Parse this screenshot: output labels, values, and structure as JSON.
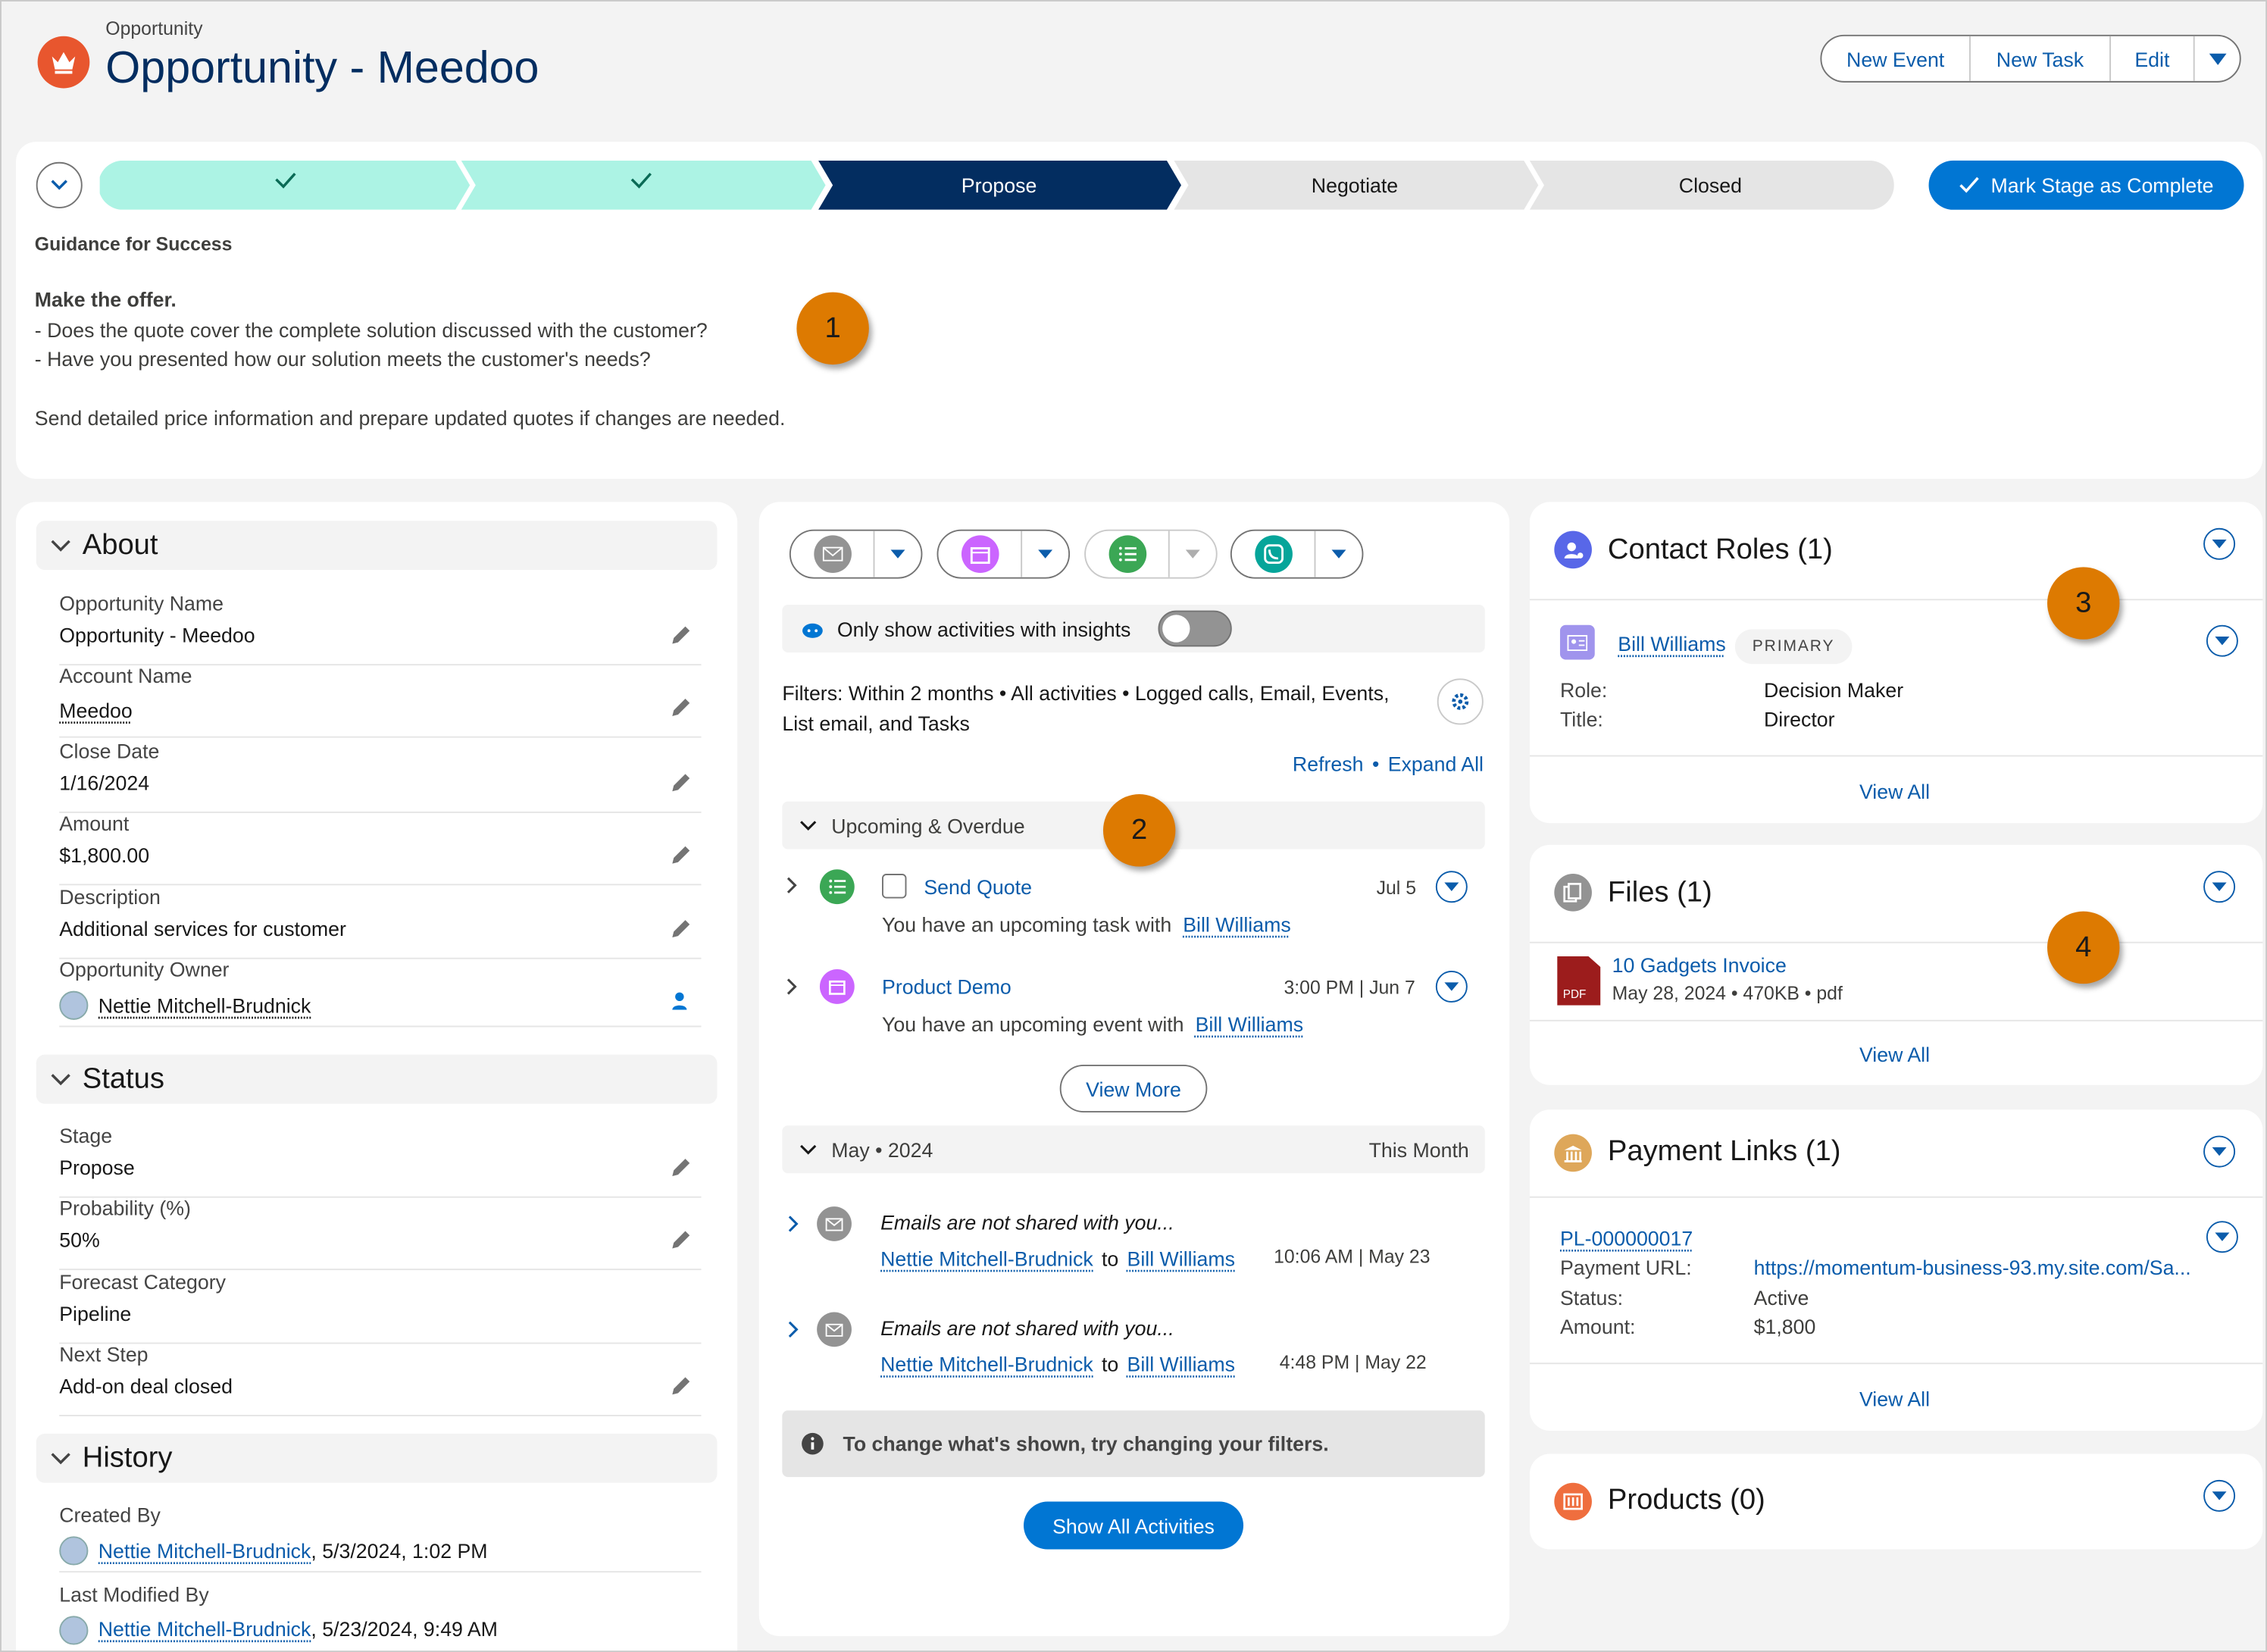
{
  "header": {
    "object_type": "Opportunity",
    "title": "Opportunity - Meedoo",
    "buttons": {
      "new_event": "New Event",
      "new_task": "New Task",
      "edit": "Edit"
    }
  },
  "path": {
    "stages": [
      "",
      "",
      "Propose",
      "Negotiate",
      "Closed"
    ],
    "mark_complete": "Mark Stage as Complete",
    "guidance_title": "Guidance for Success",
    "guidance_heading": "Make the offer.",
    "guidance_lines": [
      "- Does the quote cover the complete solution discussed with the customer?",
      "- Have you presented how our solution meets the customer's needs?"
    ],
    "guidance_footer": "Send detailed price information and prepare updated quotes if changes are needed."
  },
  "callouts": [
    "1",
    "2",
    "3",
    "4"
  ],
  "about": {
    "title": "About",
    "fields": [
      {
        "label": "Opportunity Name",
        "value": "Opportunity - Meedoo"
      },
      {
        "label": "Account Name",
        "value": "Meedoo"
      },
      {
        "label": "Close Date",
        "value": "1/16/2024"
      },
      {
        "label": "Amount",
        "value": "$1,800.00"
      },
      {
        "label": "Description",
        "value": "Additional services for customer"
      },
      {
        "label": "Opportunity Owner",
        "value": "Nettie Mitchell-Brudnick"
      }
    ]
  },
  "status": {
    "title": "Status",
    "fields": [
      {
        "label": "Stage",
        "value": "Propose"
      },
      {
        "label": "Probability (%)",
        "value": "50%"
      },
      {
        "label": "Forecast Category",
        "value": "Pipeline"
      },
      {
        "label": "Next Step",
        "value": "Add-on deal closed"
      }
    ]
  },
  "history": {
    "title": "History",
    "created_label": "Created By",
    "created_by": "Nettie Mitchell-Brudnick",
    "created_date": ", 5/3/2024, 1:02 PM",
    "modified_label": "Last Modified By",
    "modified_by": "Nettie Mitchell-Brudnick",
    "modified_date": ", 5/23/2024, 9:49 AM"
  },
  "activity": {
    "insights_toggle_label": "Only show activities with insights",
    "filters_text": "Filters: Within 2 months • All activities • Logged calls, Email, Events, List email, and Tasks",
    "refresh": "Refresh",
    "expand_all": "Expand All",
    "upcoming_title": "Upcoming & Overdue",
    "task": {
      "title": "Send Quote",
      "date": "Jul 5",
      "text": "You have an upcoming task with",
      "person": "Bill Williams"
    },
    "event": {
      "title": "Product Demo",
      "date": "3:00 PM | Jun 7",
      "text": "You have an upcoming event with",
      "person": "Bill Williams"
    },
    "view_more": "View More",
    "month_title": "May • 2024",
    "month_badge": "This Month",
    "emails": [
      {
        "subject": "Emails are not shared with you...",
        "from": "Nettie Mitchell-Brudnick",
        "to_word": "to",
        "to": "Bill Williams",
        "time": "10:06 AM | May 23"
      },
      {
        "subject": "Emails are not shared with you...",
        "from": "Nettie Mitchell-Brudnick",
        "to_word": "to",
        "to": "Bill Williams",
        "time": "4:48 PM | May 22"
      }
    ],
    "filter_notice": "To change what's shown, try changing your filters.",
    "show_all": "Show All Activities"
  },
  "contact_roles": {
    "title": "Contact Roles (1)",
    "name": "Bill Williams",
    "badge": "PRIMARY",
    "role_label": "Role:",
    "role_value": "Decision Maker",
    "title_label": "Title:",
    "title_value": "Director",
    "view_all": "View All"
  },
  "files": {
    "title": "Files (1)",
    "file_name": "10 Gadgets Invoice",
    "file_meta": "May 28, 2024 • 470KB • pdf",
    "pdf_label": "PDF",
    "view_all": "View All"
  },
  "payment_links": {
    "title": "Payment Links (1)",
    "id": "PL-000000017",
    "url_label": "Payment URL:",
    "url_value": "https://momentum-business-93.my.site.com/Sa...",
    "status_label": "Status:",
    "status_value": "Active",
    "amount_label": "Amount:",
    "amount_value": "$1,800",
    "view_all": "View All"
  },
  "products": {
    "title": "Products (0)"
  },
  "colors": {
    "brand": "#0176d3",
    "navy": "#032d60",
    "stage_done": "#acf3e4",
    "callout": "#dd7a01"
  }
}
